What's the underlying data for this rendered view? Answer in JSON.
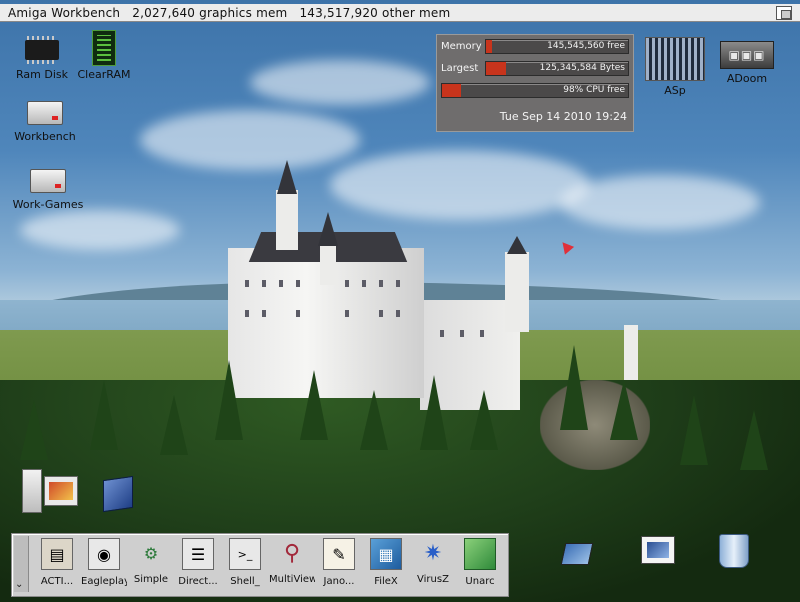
{
  "titlebar": {
    "title": "Amiga Workbench   2,027,640 graphics mem   143,517,920 other mem"
  },
  "desktop_icons": [
    {
      "label": "Ram Disk",
      "icon": "ram-chip-icon"
    },
    {
      "label": "ClearRAM",
      "icon": "circuit-board-icon"
    },
    {
      "label": "Workbench",
      "icon": "hard-drive-icon"
    },
    {
      "label": "Work-Games",
      "icon": "hard-drive-icon"
    },
    {
      "label": "ASp",
      "icon": "keyboard-app-icon"
    },
    {
      "label": "ADoom",
      "icon": "doom-logo-icon"
    }
  ],
  "monitor": {
    "memory": {
      "label": "Memory",
      "text": "145,545,560 free",
      "level": 0.04
    },
    "largest": {
      "label": "Largest",
      "text": "125,345,584 Bytes",
      "level": 0.14
    },
    "cpu": {
      "label": "",
      "text": "98% CPU free",
      "level": 0.1
    },
    "date": "Tue Sep 14 2010 19:24"
  },
  "dock": {
    "items": [
      {
        "label": "ACTI...",
        "icon": "acti-icon"
      },
      {
        "label": "Eagleplayer",
        "icon": "eagleplayer-icon"
      },
      {
        "label": "Simple",
        "icon": "wrench-icon"
      },
      {
        "label": "Direct...",
        "icon": "directory-icon"
      },
      {
        "label": "Shell_",
        "icon": "shell-icon"
      },
      {
        "label": "MultiView",
        "icon": "magnifier-icon"
      },
      {
        "label": "Jano...",
        "icon": "notepad-pen-icon"
      },
      {
        "label": "FileX",
        "icon": "filex-icon"
      },
      {
        "label": "VirusZ",
        "icon": "virusz-bug-icon"
      },
      {
        "label": "Unarc",
        "icon": "green-cube-icon"
      }
    ]
  },
  "colors": {
    "bar_fill": "#c8341c",
    "monitor_bg": "#6f6d6d",
    "titlebar_bg": "#ececec",
    "dock_bg": "#cfcfcf"
  }
}
